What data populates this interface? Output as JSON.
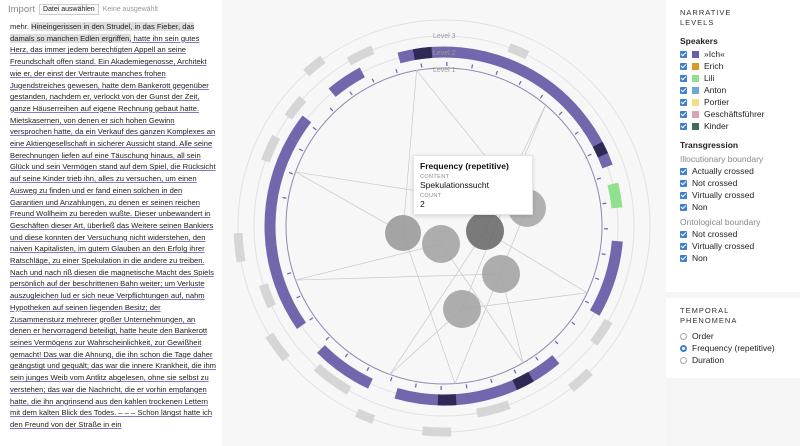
{
  "import": {
    "label": "Import",
    "button": "Datei auswählen",
    "file_status": "Keine ausgewählt"
  },
  "text_segments": [
    {
      "t": "mehr. ",
      "s": ""
    },
    {
      "t": "Hineingerissen in den Strudel, in das Fieber, das damals so manchen Edlen ergriffen,",
      "s": "hl"
    },
    {
      "t": " hatte ihn sein gutes Herz, das immer jedem berechtigten Appell an seine Freundschaft offen stand. Ein Akademiegenosse, Architekt wie er, der einst der Vertraute manches frohen Jugendstreiches gewesen, hatte dem Bankerott gegenüber gestanden, nachdem er, verlockt von der Gunst der Zeit, ganze Häuserreihen auf eigene Rechnung gebaut hatte. Mietskasernen, von denen er sich hohen Gewinn versprochen hatte, da ein Verkauf des ganzen Komplexes an eine Aktiengesellschaft in sicherer Aussicht stand. Alle seine Berechnungen liefen auf eine Täuschung hinaus, all sein Glück und sein Vermögen stand auf dem Spiel, die Rücksicht auf seine Kinder trieb ihn, alles zu versuchen, um einen Ausweg zu finden und er fand einen solchen in den Garantien und Anzahlungen, zu denen er seinen reichen Freund Wollheim zu bereden wußte. Dieser unbewandert in Geschäften dieser Art, überließ das Weitere seinen Bankiers und diese konnten der Versuchung nicht widerstehen, den naiven Kapitalisten, im gutem Glauben an den Erfolg ihrer Ratschläge, zu einer Spekulation in die andere zu treiben. Nach und nach riß diesen die magnetische Macht des Spiels persönlich auf der beschrittenen Bahn weiter; um Verluste auszugleichen lud er sich neue Verpflichtungen auf, nahm Hypotheken auf seinen liegenden Besitz; der Zusammensturz mehrerer großer Unternehmungen, an denen er hervorragend beteiligt, hatte heute den Bankerott seines Vermögens zur Wahrscheinlichkeit, zur Gewißheit gemacht! Das war die Ahnung, die ihn schon die Tage daher geängstigt und gequält; das war die innere Krankheit, die ihm sein junges Weib vom Antlitz abgelesen, ohne sie selbst zu verstehen; das war die Nachricht, die er vorhin empfangen hatte, die ihn angrinsend aus den kahlen trockenen Lettern mit dem kalten Blick des Todes. – – –",
      "s": "ul"
    },
    {
      "t": " Schon längst hatte ich den Freund von der Straße in ein",
      "s": "ul"
    }
  ],
  "levels": [
    "Level 3",
    "Level 2",
    "Level 1"
  ],
  "tooltip": {
    "title": "Frequency (repetitive)",
    "content_label": "CONTENT",
    "content": "Spekulationssucht",
    "count_label": "COUNT",
    "count": "2"
  },
  "panel": {
    "heading_line1": "NARRATIVE",
    "heading_line2": "LEVELS",
    "speakers_title": "Speakers",
    "speakers": [
      {
        "label": "»Ich«",
        "color": "#6a5fa8"
      },
      {
        "label": "Erich",
        "color": "#d99a2b"
      },
      {
        "label": "Lili",
        "color": "#8fe08f"
      },
      {
        "label": "Anton",
        "color": "#6fa7d8"
      },
      {
        "label": "Portier",
        "color": "#f3dc8a"
      },
      {
        "label": "Geschäftsführer",
        "color": "#d9a5b5"
      },
      {
        "label": "Kinder",
        "color": "#3d6e5b"
      }
    ],
    "transgression_title": "Transgression",
    "illocutionary_title": "Illocutionary boundary",
    "illocutionary": [
      "Actually crossed",
      "Not crossed",
      "Virtually crossed",
      "Non"
    ],
    "ontological_title": "Ontological boundary",
    "ontological": [
      "Not crossed",
      "Virtually crossed",
      "Non"
    ],
    "temporal_line1": "TEMPORAL",
    "temporal_line2": "PHENOMENA",
    "temporal_options": [
      {
        "label": "Order",
        "selected": false
      },
      {
        "label": "Frequency (repetitive)",
        "selected": true
      },
      {
        "label": "Duration",
        "selected": false
      }
    ]
  }
}
